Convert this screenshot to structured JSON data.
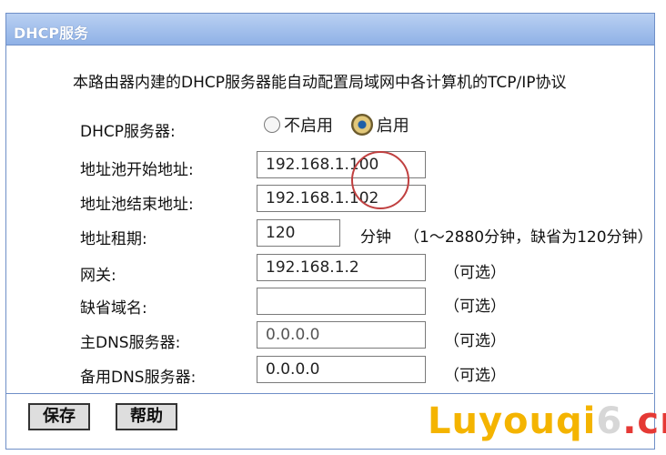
{
  "panel": {
    "title": "DHCP服务"
  },
  "intro": "本路由器内建的DHCP服务器能自动配置局域网中各计算机的TCP/IP协议",
  "dhcp_server": {
    "label": "DHCP服务器:",
    "options": [
      "不启用",
      "启用"
    ],
    "selected": "启用"
  },
  "fields": {
    "pool_start": {
      "label": "地址池开始地址:",
      "value": "192.168.1.100"
    },
    "pool_end": {
      "label": "地址池结束地址:",
      "value": "192.168.1.102"
    },
    "lease": {
      "label": "地址租期:",
      "value": "120",
      "unit": "分钟",
      "hint": "（1～2880分钟，缺省为120分钟）"
    },
    "gateway": {
      "label": "网关:",
      "value": "192.168.1.2",
      "hint": "（可选）"
    },
    "domain": {
      "label": "缺省域名:",
      "value": "",
      "hint": "（可选）"
    },
    "primary_dns": {
      "label": "主DNS服务器:",
      "value": "0.0.0.0",
      "hint": "（可选）"
    },
    "backup_dns": {
      "label": "备用DNS服务器:",
      "value": "0.0.0.0",
      "hint": "（可选）"
    }
  },
  "buttons": {
    "save": "保存",
    "help": "帮助"
  },
  "watermark": {
    "left": "Luyouqi",
    "mid": "6",
    "right": ".cn"
  },
  "colors": {
    "title_bar": "#8fb1e6",
    "border": "#6f8fc7",
    "annotation_circle": "#c04040"
  }
}
